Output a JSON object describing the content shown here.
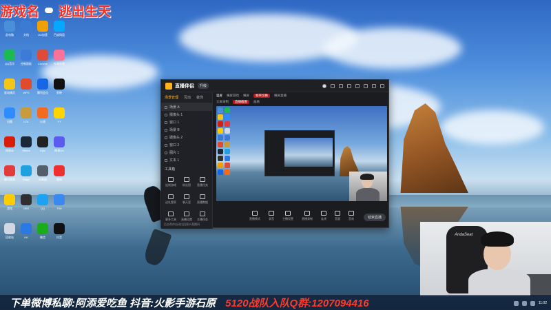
{
  "overlay": {
    "top_label": "游戏名",
    "top_game": "逃出生天",
    "bottom_left": "下单微博私聊:阿添爱吃鱼 抖音:火影手游石原",
    "bottom_right": "5120战队入队Q群:1207094416"
  },
  "app": {
    "title": "直播伴侣",
    "version": "升级",
    "side_tabs": [
      "场景管理",
      "互动",
      "装饰"
    ],
    "scenes": [
      {
        "label": "场景 A"
      },
      {
        "label": "摄像头 1"
      },
      {
        "label": "窗口 1"
      },
      {
        "label": "场景 B"
      },
      {
        "label": "摄像头 2"
      },
      {
        "label": "窗口 2"
      },
      {
        "label": "图片 1"
      },
      {
        "label": "文本 1"
      }
    ],
    "tools_title": "工具箱",
    "tools": [
      {
        "label": "连线游戏"
      },
      {
        "label": "粉丝团"
      },
      {
        "label": "直播任务"
      },
      {
        "label": "送礼管家"
      },
      {
        "label": "聊天室"
      },
      {
        "label": "直播数据"
      },
      {
        "label": "更多工具"
      },
      {
        "label": "直播设置"
      },
      {
        "label": "主播任务"
      }
    ],
    "side_status": "后台帮你自动拉回观众直播间",
    "main_tabs": [
      "竖屏",
      "横屏游戏",
      "横屏",
      "帧率切换",
      "横屏直播"
    ],
    "main_sub": [
      "大屏录制",
      "直播截图",
      "画质"
    ],
    "controls": [
      {
        "label": "直播模式"
      },
      {
        "label": "录音"
      },
      {
        "label": "主播设置"
      },
      {
        "label": "直播录制"
      },
      {
        "label": "连线"
      },
      {
        "label": "音量"
      },
      {
        "label": "音效"
      }
    ],
    "go_live": "结束直播"
  },
  "desktop": {
    "icons": [
      {
        "label": "此电脑",
        "color": "#4a90d9"
      },
      {
        "label": "QQ音乐",
        "color": "#1db954"
      },
      {
        "label": "驱动精灵",
        "color": "#f5c518"
      },
      {
        "label": "迅雷",
        "color": "#2f8cff"
      },
      {
        "label": "网易云",
        "color": "#d81e06"
      },
      {
        "label": "腾讯视频",
        "color": "#e13b3b"
      },
      {
        "label": "游戏",
        "color": "#ffcc00"
      },
      {
        "label": "回收站",
        "color": "#cfd8e3"
      },
      {
        "label": "文档",
        "color": "#3a7bd5"
      },
      {
        "label": "控制面板",
        "color": "#3e7ad8"
      },
      {
        "label": "WPS",
        "color": "#e04b2e"
      },
      {
        "label": "LOL",
        "color": "#c89b3c"
      },
      {
        "label": "Steam",
        "color": "#1b2838"
      },
      {
        "label": "Edge",
        "color": "#1fa1e0"
      },
      {
        "label": "OBS",
        "color": "#303030"
      },
      {
        "label": "KK",
        "color": "#2b79e3"
      },
      {
        "label": "UU加速",
        "color": "#f0a000"
      },
      {
        "label": "Chrome",
        "color": "#dd4b39"
      },
      {
        "label": "腾讯会议",
        "color": "#1766e3"
      },
      {
        "label": "火绒",
        "color": "#f46b20"
      },
      {
        "label": "Epic",
        "color": "#222222"
      },
      {
        "label": "计算器",
        "color": "#555f6b"
      },
      {
        "label": "QQ",
        "color": "#1da1f2"
      },
      {
        "label": "微信",
        "color": "#1aad19"
      },
      {
        "label": "百度网盘",
        "color": "#06a7ff"
      },
      {
        "label": "哔哩哔哩",
        "color": "#fb7299"
      },
      {
        "label": "剪映",
        "color": "#111111"
      },
      {
        "label": "YY",
        "color": "#ffd400"
      },
      {
        "label": "网易UU",
        "color": "#5b5bf0"
      },
      {
        "label": "雷神",
        "color": "#f03030"
      },
      {
        "label": "TIM",
        "color": "#3a88f0"
      },
      {
        "label": "抖音",
        "color": "#111111"
      }
    ]
  },
  "streamer": {
    "chair_brand": "AndaSeat"
  },
  "taskbar": {
    "time": "11:02"
  }
}
